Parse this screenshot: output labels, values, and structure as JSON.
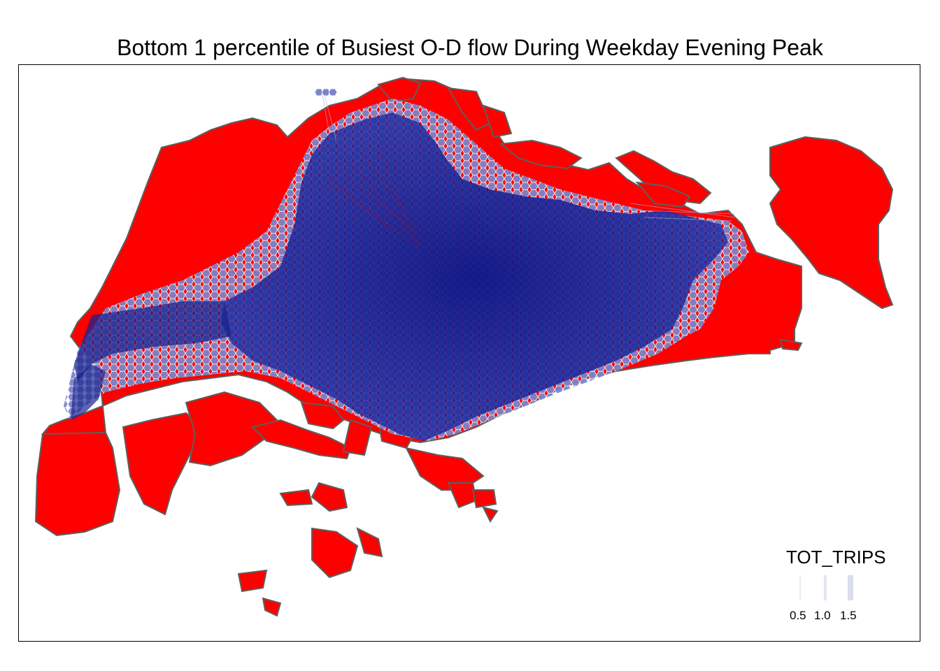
{
  "title": "Bottom 1 percentile of Busiest O-D flow During Weekday Evening Peak",
  "colors": {
    "land_fill": "#ff0000",
    "land_border": "#5e5e5e",
    "flow_line": "#101a8c",
    "hex_outline": "#e8eaf6",
    "legend_key": "#c7c9e3"
  },
  "legend": {
    "title": "TOT_TRIPS",
    "entries": [
      {
        "label": "0.5",
        "value": 0.5
      },
      {
        "label": "1.0",
        "value": 1.0
      },
      {
        "label": "1.5",
        "value": 1.5
      }
    ]
  }
}
